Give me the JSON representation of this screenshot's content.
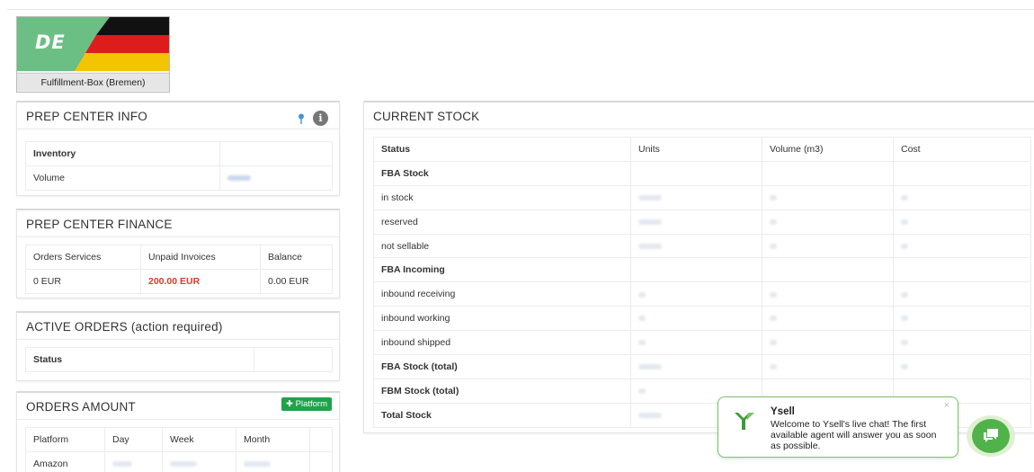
{
  "country": {
    "code": "DE",
    "label": "Fulfillment-Box (Bremen)"
  },
  "prep_info": {
    "title": "PREP CENTER INFO",
    "rows": [
      {
        "label": "Inventory"
      },
      {
        "label": "Volume"
      }
    ]
  },
  "finance": {
    "title": "PREP CENTER FINANCE",
    "headers": [
      "Orders Services",
      "Unpaid Invoices",
      "Balance"
    ],
    "values": [
      "0 EUR",
      "200.00 EUR",
      "0.00 EUR"
    ]
  },
  "active_orders": {
    "title": "ACTIVE ORDERS (action required)",
    "header": "Status"
  },
  "orders_amount": {
    "title": "ORDERS AMOUNT",
    "button": "Platform",
    "headers": [
      "Platform",
      "Day",
      "Week",
      "Month"
    ],
    "rows": [
      "Amazon"
    ]
  },
  "stock": {
    "title": "CURRENT STOCK",
    "headers": [
      "Status",
      "Units",
      "Volume (m3)",
      "Cost"
    ],
    "rows": [
      {
        "label": "FBA Stock",
        "bold": true,
        "section": true
      },
      {
        "label": "in stock"
      },
      {
        "label": "reserved"
      },
      {
        "label": "not sellable"
      },
      {
        "label": "FBA Incoming",
        "bold": true,
        "section": true
      },
      {
        "label": "inbound receiving"
      },
      {
        "label": "inbound working"
      },
      {
        "label": "inbound shipped"
      },
      {
        "label": "FBA Stock (total)",
        "bold": true
      },
      {
        "label": "FBM Stock (total)",
        "bold": true
      },
      {
        "label": "Total Stock",
        "bold": true
      }
    ]
  },
  "chat": {
    "name": "Ysell",
    "message": "Welcome to Ysell's live chat! The first available agent will answer you as soon as possible.",
    "close": "×"
  },
  "colors": {
    "accent_green": "#4fb34a",
    "unpaid_red": "#d23c2a",
    "flag_bg": "#6cbf84"
  }
}
